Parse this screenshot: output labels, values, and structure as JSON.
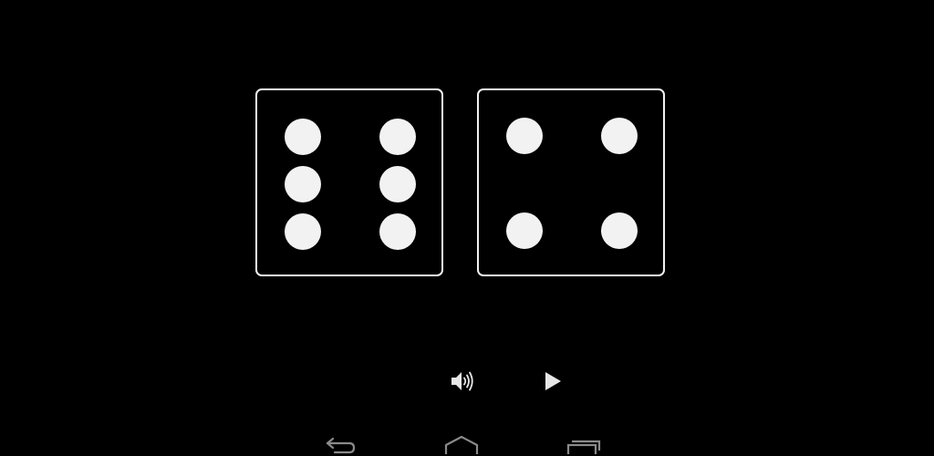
{
  "game": {
    "dice": [
      {
        "face_value": 6
      },
      {
        "face_value": 4
      }
    ],
    "colors": {
      "background": "#000000",
      "die_outline": "#f2f2f2",
      "pip": "#f2f2f2",
      "icon": "#e6e6e6",
      "nav_icon": "#8a8a8a"
    }
  },
  "controls": {
    "sound_icon": "speaker-icon",
    "play_icon": "play-icon"
  },
  "navigation_bar": {
    "back_icon": "back-arrow-icon",
    "home_icon": "home-icon",
    "recents_icon": "recent-apps-icon"
  }
}
